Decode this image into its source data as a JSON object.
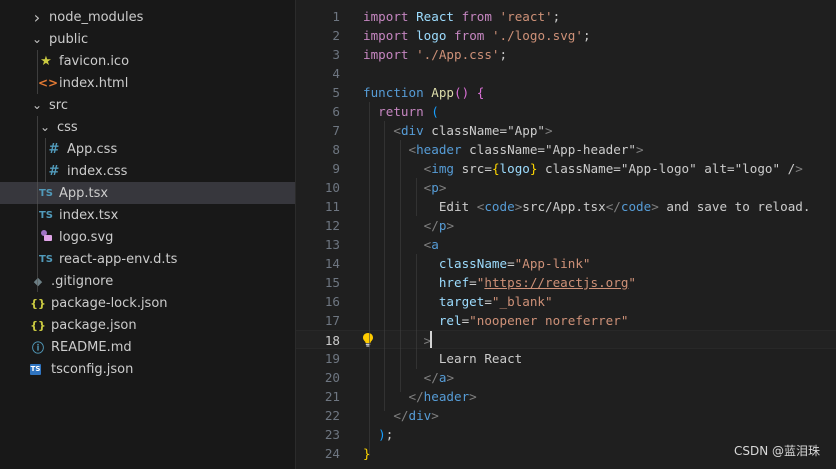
{
  "explorer": {
    "items": [
      {
        "name": "node_modules",
        "kind": "folder",
        "state": "collapsed",
        "icon": "chevron-right-icon"
      },
      {
        "name": "public",
        "kind": "folder",
        "state": "expanded",
        "icon": "chevron-down-icon"
      },
      {
        "name": "favicon.ico",
        "kind": "file",
        "icon": "favicon-icon"
      },
      {
        "name": "index.html",
        "kind": "file",
        "icon": "html-icon"
      },
      {
        "name": "src",
        "kind": "folder",
        "state": "expanded",
        "icon": "chevron-down-icon"
      },
      {
        "name": "css",
        "kind": "folder",
        "state": "expanded",
        "icon": "chevron-down-icon"
      },
      {
        "name": "App.css",
        "kind": "file",
        "icon": "css-icon"
      },
      {
        "name": "index.css",
        "kind": "file",
        "icon": "css-icon"
      },
      {
        "name": "App.tsx",
        "kind": "file",
        "icon": "typescript-icon",
        "selected": true
      },
      {
        "name": "index.tsx",
        "kind": "file",
        "icon": "typescript-icon"
      },
      {
        "name": "logo.svg",
        "kind": "file",
        "icon": "svg-icon"
      },
      {
        "name": "react-app-env.d.ts",
        "kind": "file",
        "icon": "typescript-icon"
      },
      {
        "name": ".gitignore",
        "kind": "file",
        "icon": "git-icon"
      },
      {
        "name": "package-lock.json",
        "kind": "file",
        "icon": "json-icon"
      },
      {
        "name": "package.json",
        "kind": "file",
        "icon": "json-icon"
      },
      {
        "name": "README.md",
        "kind": "file",
        "icon": "info-icon"
      },
      {
        "name": "tsconfig.json",
        "kind": "file",
        "icon": "tsconfig-icon"
      }
    ],
    "icon_glyphs": {
      "ts": "TS",
      "css": "#",
      "json": "{}",
      "html": "<>",
      "info": "ⓘ",
      "star": "★",
      "git": "◆",
      "tsconfig": "TS"
    }
  },
  "editor": {
    "file": "App.tsx",
    "current_line": 18,
    "lines": [
      "import React from 'react';",
      "import logo from './logo.svg';",
      "import './App.css';",
      "",
      "function App() {",
      "  return (",
      "    <div className=\"App\">",
      "      <header className=\"App-header\">",
      "        <img src={logo} className=\"App-logo\" alt=\"logo\" />",
      "        <p>",
      "          Edit <code>src/App.tsx</code> and save to reload.",
      "        </p>",
      "        <a",
      "          className=\"App-link\"",
      "          href=\"https://reactjs.org\"",
      "          target=\"_blank\"",
      "          rel=\"noopener noreferrer\"",
      "        >",
      "          Learn React",
      "        </a>",
      "      </header>",
      "    </div>",
      "  );",
      "}"
    ]
  },
  "colors": {
    "keyword": "#c586c0",
    "storage": "#569cd6",
    "function": "#dcdcaa",
    "string": "#ce9178",
    "variable": "#9cdcfe",
    "tag": "#569cd6",
    "punctuation": "#808080",
    "text": "#cccccc",
    "bracket_gold": "#ffd700",
    "bracket_pink": "#da70d6",
    "bracket_blue": "#179fff"
  },
  "watermark": "CSDN @蓝泪珠"
}
